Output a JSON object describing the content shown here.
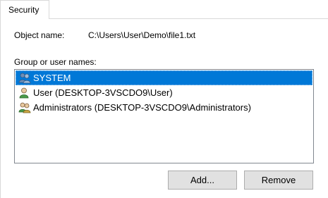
{
  "tabs": [
    {
      "label": "Security",
      "active": true
    }
  ],
  "object": {
    "label": "Object name:",
    "value": "C:\\Users\\User\\Demo\\file1.txt"
  },
  "group_list": {
    "label": "Group or user names:",
    "selected_index": 0,
    "items": [
      {
        "name": "SYSTEM",
        "icon": "group-users-icon",
        "selected": true
      },
      {
        "name": "User (DESKTOP-3VSCDO9\\User)",
        "icon": "user-icon",
        "selected": false
      },
      {
        "name": "Administrators (DESKTOP-3VSCDO9\\Administrators)",
        "icon": "group-users-icon",
        "selected": false
      }
    ]
  },
  "buttons": {
    "add_label": "Add...",
    "remove_label": "Remove"
  },
  "colors": {
    "selection": "#0078d7",
    "button_face": "#e1e1e1",
    "border": "#adadad"
  }
}
